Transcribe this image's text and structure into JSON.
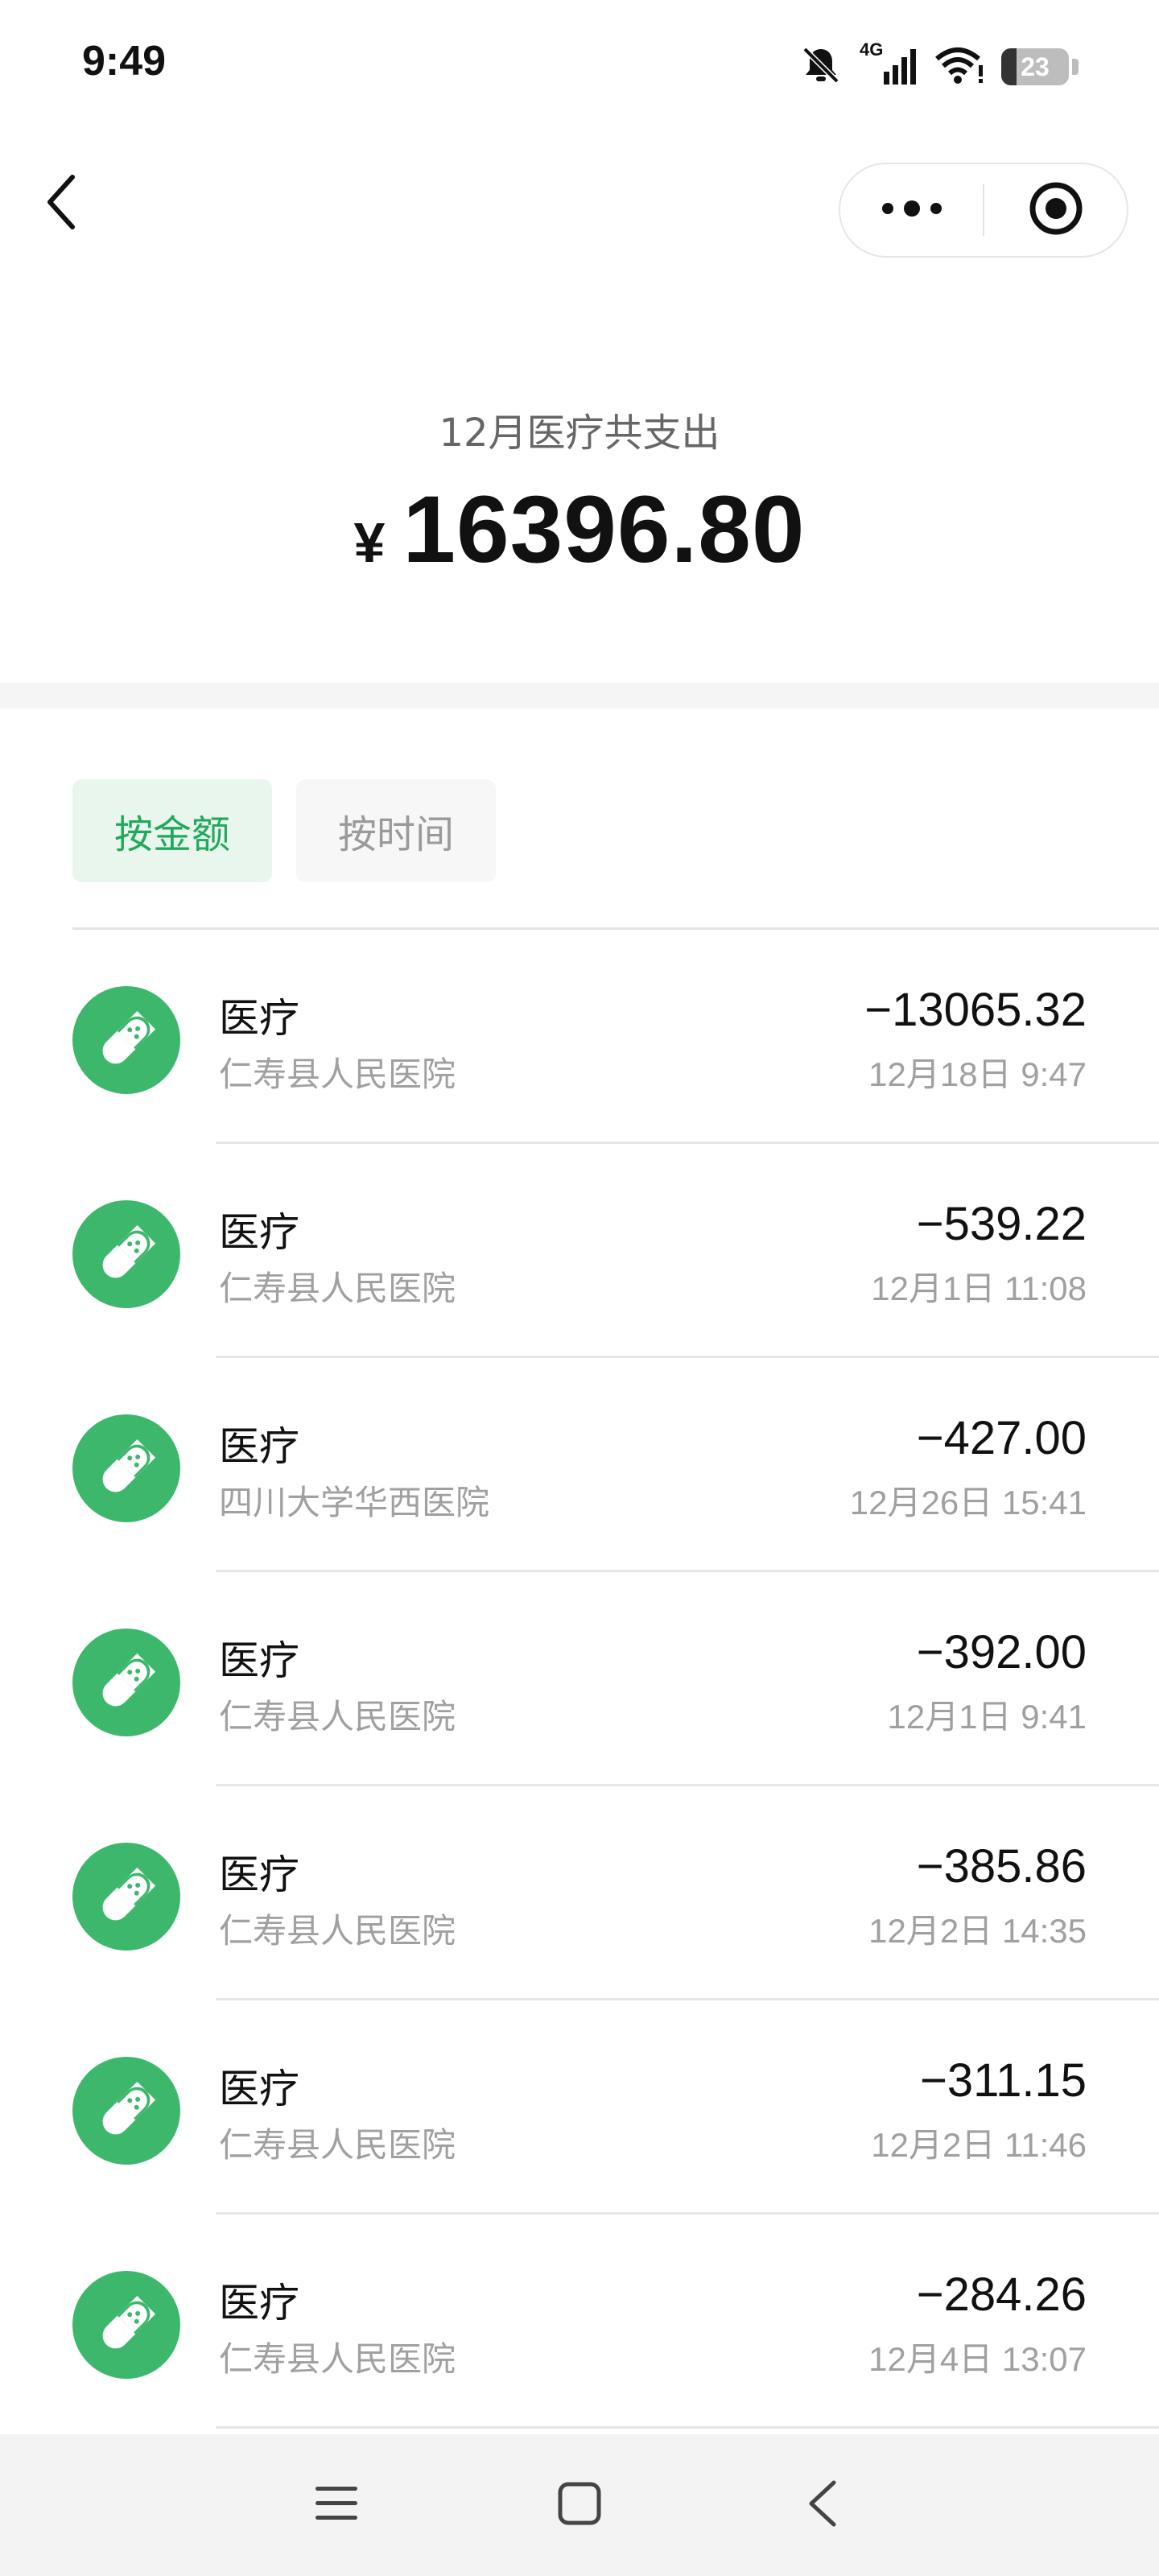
{
  "status_bar": {
    "time": "9:49",
    "network": "4G",
    "battery": "23"
  },
  "header": {
    "back_icon": "chevron-left-icon",
    "more_icon": "more-dots-icon",
    "close_icon": "target-circle-icon"
  },
  "summary": {
    "label": "12月医疗共支出",
    "currency": "¥",
    "amount": "16396.80"
  },
  "sort_tabs": [
    {
      "label": "按金额",
      "active": true
    },
    {
      "label": "按时间",
      "active": false
    }
  ],
  "transactions": [
    {
      "title": "医疗",
      "merchant": "仁寿县人民医院",
      "amount": "−13065.32",
      "time": "12月18日 9:47"
    },
    {
      "title": "医疗",
      "merchant": "仁寿县人民医院",
      "amount": "−539.22",
      "time": "12月1日 11:08"
    },
    {
      "title": "医疗",
      "merchant": "四川大学华西医院",
      "amount": "−427.00",
      "time": "12月26日 15:41"
    },
    {
      "title": "医疗",
      "merchant": "仁寿县人民医院",
      "amount": "−392.00",
      "time": "12月1日 9:41"
    },
    {
      "title": "医疗",
      "merchant": "仁寿县人民医院",
      "amount": "−385.86",
      "time": "12月2日 14:35"
    },
    {
      "title": "医疗",
      "merchant": "仁寿县人民医院",
      "amount": "−311.15",
      "time": "12月2日 11:46"
    },
    {
      "title": "医疗",
      "merchant": "仁寿县人民医院",
      "amount": "−284.26",
      "time": "12月4日 13:07"
    }
  ],
  "colors": {
    "accent": "#3db76c",
    "accent_text": "#22a95b",
    "muted_text": "#a0a0a0"
  },
  "nav_bar": {
    "icons": [
      "menu-icon",
      "home-square-icon",
      "back-triangle-icon"
    ]
  }
}
